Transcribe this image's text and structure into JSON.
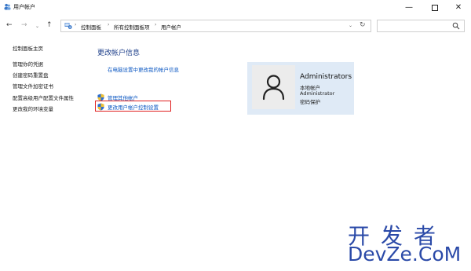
{
  "window": {
    "title": "用户帐户",
    "icon": "users-icon",
    "controls": {
      "minimize": "—",
      "maximize": "max-icon",
      "close": "✕"
    }
  },
  "nav": {
    "back": "←",
    "forward": "→",
    "recent": "⌄",
    "up": "↑"
  },
  "address": {
    "crumbs": [
      "控制面板",
      "所有控制面板项",
      "用户帐户"
    ],
    "separator": "›",
    "dropdown": "⌄",
    "refresh": "↻"
  },
  "search": {
    "placeholder": ""
  },
  "sidebar": {
    "items": [
      {
        "label": "控制面板主页"
      },
      {
        "label": "管理你的凭据"
      },
      {
        "label": "创建密码重置盘"
      },
      {
        "label": "管理文件加密证书"
      },
      {
        "label": "配置高级用户配置文件属性"
      },
      {
        "label": "更改我的环境变量"
      }
    ]
  },
  "main": {
    "title": "更改帐户信息",
    "pc_settings_link": "在电脑设置中更改我的帐户信息",
    "actions": [
      {
        "label": "管理其他帐户",
        "icon": "uac-shield-icon"
      },
      {
        "label": "更改用户帐户控制设置",
        "icon": "uac-shield-icon",
        "highlighted": true
      }
    ]
  },
  "account": {
    "name": "Administrators",
    "type": "本地帐户",
    "group": "Administrator",
    "password": "密码保护",
    "avatar": "user-avatar-icon"
  },
  "watermark": {
    "cn": "开发者",
    "en": "DevZe.CoM"
  },
  "colors": {
    "link": "#0b57c2",
    "title": "#1e3f8a",
    "card": "#dfeaf6",
    "highlight": "#e02020",
    "watermark": "#2b4aa8"
  }
}
